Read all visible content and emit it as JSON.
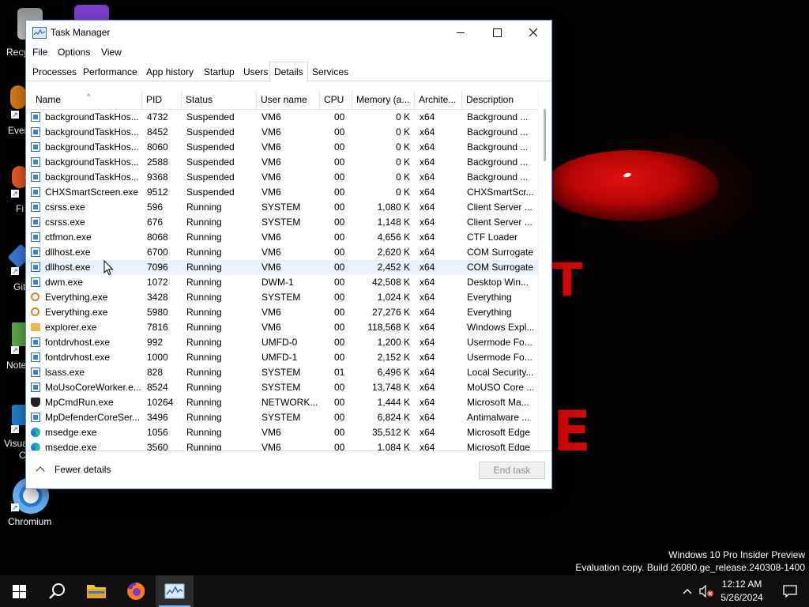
{
  "desktop": {
    "icons": [
      {
        "label": "Recy"
      },
      {
        "label": "Ever"
      },
      {
        "label": "Fi"
      },
      {
        "label": "Git"
      },
      {
        "label": "Note"
      },
      {
        "label": "Visua"
      },
      {
        "label": "C"
      },
      {
        "label": "Chromium"
      }
    ],
    "watermark_line1": "Windows 10 Pro Insider Preview",
    "watermark_line2": "Evaluation copy. Build 26080.ge_release.240308-1400"
  },
  "window": {
    "title": "Task Manager",
    "icon": "task-manager-icon",
    "controls": {
      "minimize": "minimize-icon",
      "maximize": "maximize-icon",
      "close": "close-icon"
    }
  },
  "menu": [
    "File",
    "Options",
    "View"
  ],
  "tabs": [
    "Processes",
    "Performance",
    "App history",
    "Startup",
    "Users",
    "Details",
    "Services"
  ],
  "selected_tab": "Details",
  "columns": [
    "Name",
    "PID",
    "Status",
    "User name",
    "CPU",
    "Memory (a...",
    "Archite...",
    "Description"
  ],
  "processes": [
    {
      "icon": "app",
      "name": "backgroundTaskHos...",
      "pid": "4732",
      "status": "Suspended",
      "user": "VM6",
      "cpu": "00",
      "memory": "0 K",
      "arch": "x64",
      "desc": "Background ..."
    },
    {
      "icon": "app",
      "name": "backgroundTaskHos...",
      "pid": "8452",
      "status": "Suspended",
      "user": "VM6",
      "cpu": "00",
      "memory": "0 K",
      "arch": "x64",
      "desc": "Background ..."
    },
    {
      "icon": "app",
      "name": "backgroundTaskHos...",
      "pid": "8060",
      "status": "Suspended",
      "user": "VM6",
      "cpu": "00",
      "memory": "0 K",
      "arch": "x64",
      "desc": "Background ..."
    },
    {
      "icon": "app",
      "name": "backgroundTaskHos...",
      "pid": "2588",
      "status": "Suspended",
      "user": "VM6",
      "cpu": "00",
      "memory": "0 K",
      "arch": "x64",
      "desc": "Background ..."
    },
    {
      "icon": "app",
      "name": "backgroundTaskHos...",
      "pid": "9368",
      "status": "Suspended",
      "user": "VM6",
      "cpu": "00",
      "memory": "0 K",
      "arch": "x64",
      "desc": "Background ..."
    },
    {
      "icon": "app",
      "name": "CHXSmartScreen.exe",
      "pid": "9512",
      "status": "Suspended",
      "user": "VM6",
      "cpu": "00",
      "memory": "0 K",
      "arch": "x64",
      "desc": "CHXSmartScr..."
    },
    {
      "icon": "app",
      "name": "csrss.exe",
      "pid": "596",
      "status": "Running",
      "user": "SYSTEM",
      "cpu": "00",
      "memory": "1,080 K",
      "arch": "x64",
      "desc": "Client Server ..."
    },
    {
      "icon": "app",
      "name": "csrss.exe",
      "pid": "676",
      "status": "Running",
      "user": "SYSTEM",
      "cpu": "00",
      "memory": "1,148 K",
      "arch": "x64",
      "desc": "Client Server ..."
    },
    {
      "icon": "app",
      "name": "ctfmon.exe",
      "pid": "8068",
      "status": "Running",
      "user": "VM6",
      "cpu": "00",
      "memory": "4,656 K",
      "arch": "x64",
      "desc": "CTF Loader"
    },
    {
      "icon": "app",
      "name": "dllhost.exe",
      "pid": "6700",
      "status": "Running",
      "user": "VM6",
      "cpu": "00",
      "memory": "2,620 K",
      "arch": "x64",
      "desc": "COM Surrogate"
    },
    {
      "icon": "app",
      "name": "dllhost.exe",
      "pid": "7096",
      "status": "Running",
      "user": "VM6",
      "cpu": "00",
      "memory": "2,452 K",
      "arch": "x64",
      "desc": "COM Surrogate",
      "hover": true
    },
    {
      "icon": "app",
      "name": "dwm.exe",
      "pid": "1072",
      "status": "Running",
      "user": "DWM-1",
      "cpu": "00",
      "memory": "42,508 K",
      "arch": "x64",
      "desc": "Desktop Win..."
    },
    {
      "icon": "key",
      "name": "Everything.exe",
      "pid": "3428",
      "status": "Running",
      "user": "SYSTEM",
      "cpu": "00",
      "memory": "1,024 K",
      "arch": "x64",
      "desc": "Everything"
    },
    {
      "icon": "key",
      "name": "Everything.exe",
      "pid": "5980",
      "status": "Running",
      "user": "VM6",
      "cpu": "00",
      "memory": "27,276 K",
      "arch": "x64",
      "desc": "Everything"
    },
    {
      "icon": "folder",
      "name": "explorer.exe",
      "pid": "7816",
      "status": "Running",
      "user": "VM6",
      "cpu": "00",
      "memory": "118,568 K",
      "arch": "x64",
      "desc": "Windows Expl..."
    },
    {
      "icon": "app",
      "name": "fontdrvhost.exe",
      "pid": "992",
      "status": "Running",
      "user": "UMFD-0",
      "cpu": "00",
      "memory": "1,200 K",
      "arch": "x64",
      "desc": "Usermode Fo..."
    },
    {
      "icon": "app",
      "name": "fontdrvhost.exe",
      "pid": "1000",
      "status": "Running",
      "user": "UMFD-1",
      "cpu": "00",
      "memory": "2,152 K",
      "arch": "x64",
      "desc": "Usermode Fo..."
    },
    {
      "icon": "app",
      "name": "lsass.exe",
      "pid": "828",
      "status": "Running",
      "user": "SYSTEM",
      "cpu": "01",
      "memory": "6,496 K",
      "arch": "x64",
      "desc": "Local Security..."
    },
    {
      "icon": "app",
      "name": "MoUsoCoreWorker.e...",
      "pid": "8524",
      "status": "Running",
      "user": "SYSTEM",
      "cpu": "00",
      "memory": "13,748 K",
      "arch": "x64",
      "desc": "MoUSO Core ..."
    },
    {
      "icon": "shield",
      "name": "MpCmdRun.exe",
      "pid": "10264",
      "status": "Running",
      "user": "NETWORK...",
      "cpu": "00",
      "memory": "1,444 K",
      "arch": "x64",
      "desc": "Microsoft Ma..."
    },
    {
      "icon": "app",
      "name": "MpDefenderCoreSer...",
      "pid": "3496",
      "status": "Running",
      "user": "SYSTEM",
      "cpu": "00",
      "memory": "6,824 K",
      "arch": "x64",
      "desc": "Antimalware ..."
    },
    {
      "icon": "edge",
      "name": "msedge.exe",
      "pid": "1056",
      "status": "Running",
      "user": "VM6",
      "cpu": "00",
      "memory": "35,512 K",
      "arch": "x64",
      "desc": "Microsoft Edge"
    },
    {
      "icon": "edge",
      "name": "msedge.exe",
      "pid": "3560",
      "status": "Running",
      "user": "VM6",
      "cpu": "00",
      "memory": "1,084 K",
      "arch": "x64",
      "desc": "Microsoft Edge"
    }
  ],
  "footer": {
    "fewer_details": "Fewer details",
    "end_task": "End task"
  },
  "taskbar": {
    "time": "12:12 AM",
    "date": "5/26/2024",
    "pinned": [
      "start-icon",
      "search-icon",
      "file-explorer-icon",
      "firefox-icon",
      "task-manager-icon"
    ],
    "active": "task-manager-icon"
  }
}
